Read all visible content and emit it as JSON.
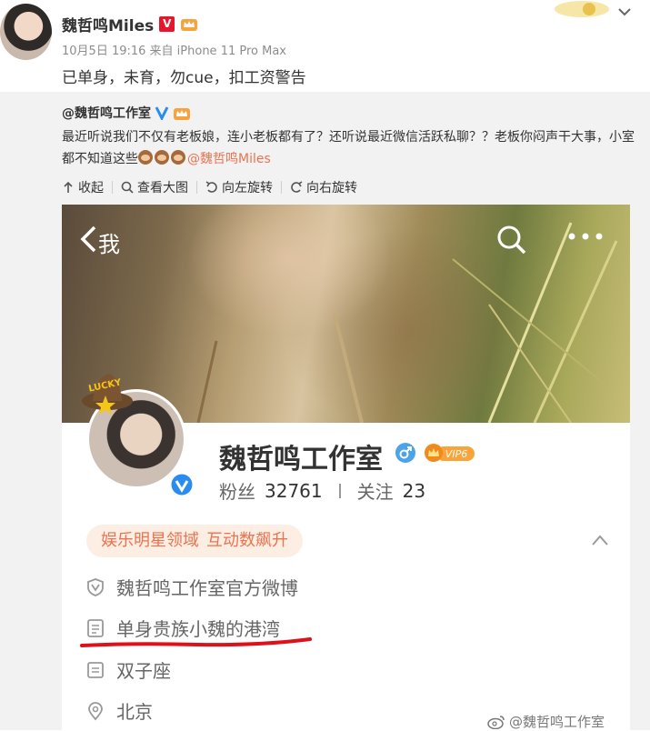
{
  "post": {
    "author": "魏哲鸣Miles",
    "meta": "10月5日 19:16 来自 iPhone 11 Pro Max",
    "text": "已单身，未育，勿cue，扣工资警告",
    "verified_mark": "V"
  },
  "repost": {
    "author": "@魏哲鸣工作室",
    "text_main": "最近听说我们不仅有老板娘，连小老板都有了？还听说最近微信活跃私聊？？老板你闷声干大事，小室都不知道这些",
    "mention": "@魏哲鸣Miles",
    "actions": [
      {
        "label": "收起",
        "icon": "collapse-icon"
      },
      {
        "label": "查看大图",
        "icon": "magnifier-icon"
      },
      {
        "label": "向左旋转",
        "icon": "rotate-left-icon"
      },
      {
        "label": "向右旋转",
        "icon": "rotate-right-icon"
      }
    ]
  },
  "profile": {
    "back_label": "我",
    "name": "魏哲鸣工作室",
    "vip_label": "VIP6",
    "lucky_text": "LUCKY",
    "fans_label": "粉丝",
    "fans_count": "32761",
    "follow_label": "关注",
    "follow_count": "23",
    "tag_1": "娱乐明星领域",
    "tag_2": "互动数飙升",
    "verify_info": "魏哲鸣工作室官方微博",
    "bio": "单身贵族小魏的港湾",
    "zodiac": "双子座",
    "location": "北京"
  },
  "watermark": "@魏哲鸣工作室",
  "colors": {
    "mention": "#eb7350",
    "verified_red": "#e6162d",
    "verified_blue": "#2b8cf0",
    "underline_red": "#e0101a",
    "repost_bg": "#f2f2f2"
  }
}
